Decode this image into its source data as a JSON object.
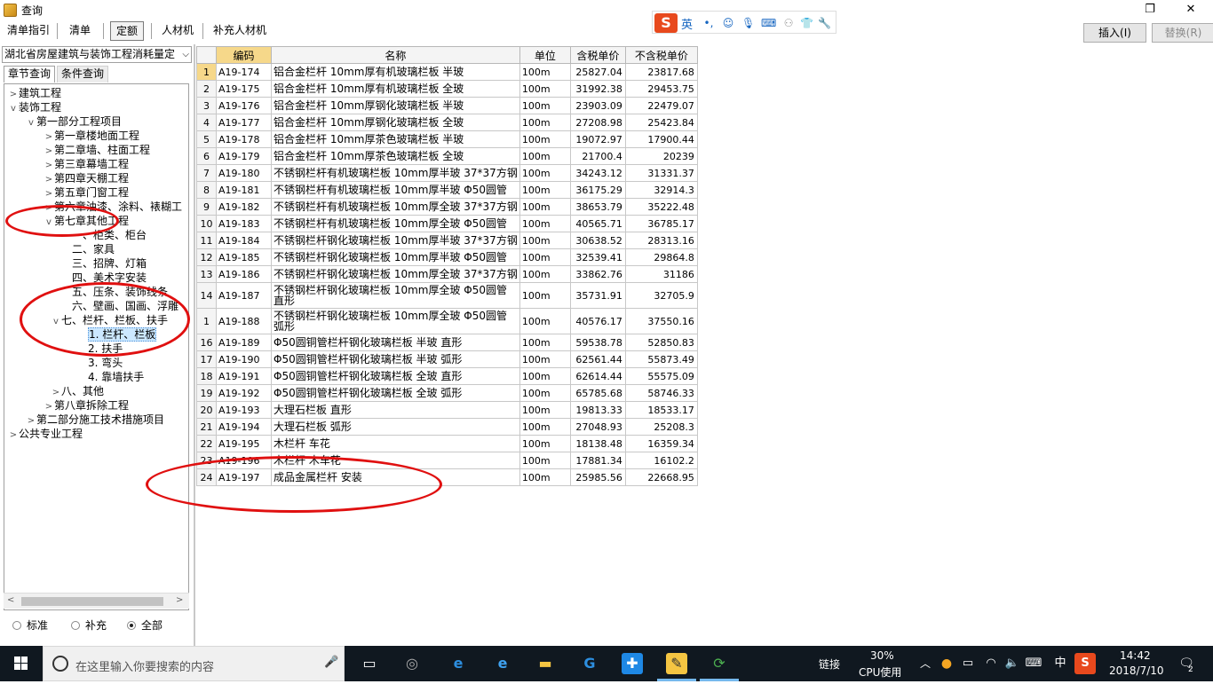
{
  "window": {
    "title": "查询",
    "restore_icon": "restore-icon",
    "close_icon": "close-icon"
  },
  "toolbar": {
    "tabs": [
      {
        "label": "清单指引"
      },
      {
        "label": "清单"
      },
      {
        "label": "定额"
      },
      {
        "label": "人材机"
      },
      {
        "label": "补充人材机"
      }
    ],
    "active_tab": "定额",
    "insert_label": "插入(I)",
    "replace_label": "替换(R)"
  },
  "ime": {
    "logo": "S",
    "lang": "英"
  },
  "left": {
    "library": "湖北省房屋建筑与装饰工程消耗量定",
    "tabs": [
      {
        "label": "章节查询"
      },
      {
        "label": "条件查询"
      }
    ],
    "tree": [
      {
        "label": "建筑工程",
        "exp": ">"
      },
      {
        "label": "装饰工程",
        "exp": "v"
      },
      {
        "label": "第一部分工程项目",
        "exp": "v"
      },
      {
        "label": "第一章楼地面工程",
        "exp": ">"
      },
      {
        "label": "第二章墙、柱面工程",
        "exp": ">"
      },
      {
        "label": "第三章幕墙工程",
        "exp": ">"
      },
      {
        "label": "第四章天棚工程",
        "exp": ">"
      },
      {
        "label": "第五章门窗工程",
        "exp": ">"
      },
      {
        "label": "第六章油漆、涂料、裱糊工",
        "exp": ">"
      },
      {
        "label": "第七章其他工程",
        "exp": "v"
      },
      {
        "label": "一、柜类、柜台",
        "exp": ""
      },
      {
        "label": "二、家具",
        "exp": ""
      },
      {
        "label": "三、招牌、灯箱",
        "exp": ""
      },
      {
        "label": "四、美术字安装",
        "exp": ""
      },
      {
        "label": "五、压条、装饰线条",
        "exp": ""
      },
      {
        "label": "六、壁画、国画、浮雕",
        "exp": ""
      },
      {
        "label": "七、栏杆、栏板、扶手",
        "exp": "v"
      },
      {
        "label": "1. 栏杆、栏板",
        "exp": ""
      },
      {
        "label": "2. 扶手",
        "exp": ""
      },
      {
        "label": "3. 弯头",
        "exp": ""
      },
      {
        "label": "4. 靠墙扶手",
        "exp": ""
      },
      {
        "label": "八、其他",
        "exp": ">"
      },
      {
        "label": "第八章拆除工程",
        "exp": ">"
      },
      {
        "label": "第二部分施工技术措施项目",
        "exp": ">"
      },
      {
        "label": "公共专业工程",
        "exp": ">"
      }
    ],
    "radios": [
      {
        "label": "标准",
        "checked": false
      },
      {
        "label": "补充",
        "checked": false
      },
      {
        "label": "全部",
        "checked": true
      }
    ]
  },
  "table": {
    "headers": [
      "",
      "编码",
      "名称",
      "单位",
      "含税单价",
      "不含税单价"
    ],
    "rows": [
      {
        "no": "1",
        "code": "A19-174",
        "name": "铝合金栏杆 10mm厚有机玻璃栏板 半玻",
        "unit": "100m",
        "tax": "25827.04",
        "notax": "23817.68"
      },
      {
        "no": "2",
        "code": "A19-175",
        "name": "铝合金栏杆 10mm厚有机玻璃栏板 全玻",
        "unit": "100m",
        "tax": "31992.38",
        "notax": "29453.75"
      },
      {
        "no": "3",
        "code": "A19-176",
        "name": "铝合金栏杆 10mm厚钢化玻璃栏板 半玻",
        "unit": "100m",
        "tax": "23903.09",
        "notax": "22479.07"
      },
      {
        "no": "4",
        "code": "A19-177",
        "name": "铝合金栏杆 10mm厚钢化玻璃栏板 全玻",
        "unit": "100m",
        "tax": "27208.98",
        "notax": "25423.84"
      },
      {
        "no": "5",
        "code": "A19-178",
        "name": "铝合金栏杆 10mm厚茶色玻璃栏板 半玻",
        "unit": "100m",
        "tax": "19072.97",
        "notax": "17900.44"
      },
      {
        "no": "6",
        "code": "A19-179",
        "name": "铝合金栏杆 10mm厚茶色玻璃栏板 全玻",
        "unit": "100m",
        "tax": "21700.4",
        "notax": "20239"
      },
      {
        "no": "7",
        "code": "A19-180",
        "name": "不锈钢栏杆有机玻璃栏板 10mm厚半玻 37*37方钢",
        "unit": "100m",
        "tax": "34243.12",
        "notax": "31331.37"
      },
      {
        "no": "8",
        "code": "A19-181",
        "name": "不锈钢栏杆有机玻璃栏板 10mm厚半玻 Φ50圆管",
        "unit": "100m",
        "tax": "36175.29",
        "notax": "32914.3"
      },
      {
        "no": "9",
        "code": "A19-182",
        "name": "不锈钢栏杆有机玻璃栏板 10mm厚全玻 37*37方钢",
        "unit": "100m",
        "tax": "38653.79",
        "notax": "35222.48"
      },
      {
        "no": "10",
        "code": "A19-183",
        "name": "不锈钢栏杆有机玻璃栏板 10mm厚全玻 Φ50圆管",
        "unit": "100m",
        "tax": "40565.71",
        "notax": "36785.17"
      },
      {
        "no": "11",
        "code": "A19-184",
        "name": "不锈钢栏杆钢化玻璃栏板 10mm厚半玻 37*37方钢",
        "unit": "100m",
        "tax": "30638.52",
        "notax": "28313.16"
      },
      {
        "no": "12",
        "code": "A19-185",
        "name": "不锈钢栏杆钢化玻璃栏板 10mm厚半玻 Φ50圆管",
        "unit": "100m",
        "tax": "32539.41",
        "notax": "29864.8"
      },
      {
        "no": "13",
        "code": "A19-186",
        "name": "不锈钢栏杆钢化玻璃栏板 10mm厚全玻 37*37方钢",
        "unit": "100m",
        "tax": "33862.76",
        "notax": "31186"
      },
      {
        "no": "14",
        "code": "A19-187",
        "name": "不锈钢栏杆钢化玻璃栏板 10mm厚全玻 Φ50圆管 直形",
        "unit": "100m",
        "tax": "35731.91",
        "notax": "32705.9"
      },
      {
        "no": "1",
        "code": "A19-188",
        "name": "不锈钢栏杆钢化玻璃栏板 10mm厚全玻 Φ50圆管 弧形",
        "unit": "100m",
        "tax": "40576.17",
        "notax": "37550.16"
      },
      {
        "no": "16",
        "code": "A19-189",
        "name": "Φ50圆铜管栏杆钢化玻璃栏板 半玻 直形",
        "unit": "100m",
        "tax": "59538.78",
        "notax": "52850.83"
      },
      {
        "no": "17",
        "code": "A19-190",
        "name": "Φ50圆铜管栏杆钢化玻璃栏板 半玻 弧形",
        "unit": "100m",
        "tax": "62561.44",
        "notax": "55873.49"
      },
      {
        "no": "18",
        "code": "A19-191",
        "name": "Φ50圆铜管栏杆钢化玻璃栏板 全玻 直形",
        "unit": "100m",
        "tax": "62614.44",
        "notax": "55575.09"
      },
      {
        "no": "19",
        "code": "A19-192",
        "name": "Φ50圆铜管栏杆钢化玻璃栏板 全玻 弧形",
        "unit": "100m",
        "tax": "65785.68",
        "notax": "58746.33"
      },
      {
        "no": "20",
        "code": "A19-193",
        "name": "大理石栏板 直形",
        "unit": "100m",
        "tax": "19813.33",
        "notax": "18533.17"
      },
      {
        "no": "21",
        "code": "A19-194",
        "name": "大理石栏板 弧形",
        "unit": "100m",
        "tax": "27048.93",
        "notax": "25208.3"
      },
      {
        "no": "22",
        "code": "A19-195",
        "name": "木栏杆 车花",
        "unit": "100m",
        "tax": "18138.48",
        "notax": "16359.34"
      },
      {
        "no": "23",
        "code": "A19-196",
        "name": "木栏杆 木车花",
        "unit": "100m",
        "tax": "17881.34",
        "notax": "16102.2"
      },
      {
        "no": "24",
        "code": "A19-197",
        "name": "成品金属栏杆 安装",
        "unit": "100m",
        "tax": "25985.56",
        "notax": "22668.95"
      }
    ]
  },
  "taskbar": {
    "search_placeholder": "在这里输入你要搜索的内容",
    "link_label": "链接",
    "cpu_percent": "30%",
    "cpu_label": "CPU使用",
    "ime_lang": "中",
    "time": "14:42",
    "date": "2018/7/10",
    "notification_count": "2"
  },
  "colors": {
    "annotation": "#e01010",
    "header_highlight": "#f6d88a",
    "selection": "#cce8ff",
    "taskbar": "#101820"
  }
}
